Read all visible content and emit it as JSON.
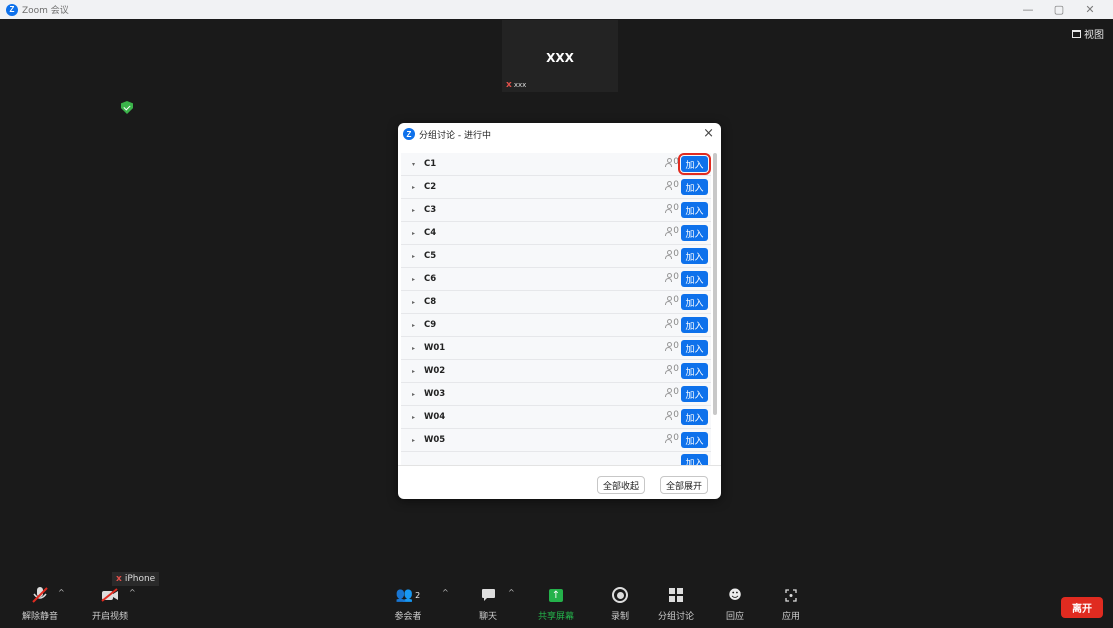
{
  "window": {
    "app_title": "Zoom 会议",
    "logo_letter": "Z",
    "view_label": "视图"
  },
  "participant_tile": {
    "name": "XXX",
    "label": "xxx"
  },
  "breakout_dialog": {
    "title": "分组讨论 - 进行中",
    "close": "×",
    "join_label": "加入",
    "rooms": [
      {
        "name": "C1",
        "count": "0",
        "expanded": true
      },
      {
        "name": "C2",
        "count": "0",
        "expanded": false
      },
      {
        "name": "C3",
        "count": "0",
        "expanded": false
      },
      {
        "name": "C4",
        "count": "0",
        "expanded": false
      },
      {
        "name": "C5",
        "count": "0",
        "expanded": false
      },
      {
        "name": "C6",
        "count": "0",
        "expanded": false
      },
      {
        "name": "C8",
        "count": "0",
        "expanded": false
      },
      {
        "name": "C9",
        "count": "0",
        "expanded": false
      },
      {
        "name": "W01",
        "count": "0",
        "expanded": false
      },
      {
        "name": "W02",
        "count": "0",
        "expanded": false
      },
      {
        "name": "W03",
        "count": "0",
        "expanded": false
      },
      {
        "name": "W04",
        "count": "0",
        "expanded": false
      },
      {
        "name": "W05",
        "count": "0",
        "expanded": false
      }
    ],
    "collapse_all": "全部收起",
    "expand_all": "全部展开"
  },
  "self_view": {
    "name": "iPhone"
  },
  "toolbar": {
    "unmute": "解除静音",
    "start_video": "开启视频",
    "participants": "参会者",
    "participants_count": "2",
    "chat": "聊天",
    "share_screen": "共享屏幕",
    "record": "录制",
    "breakout": "分组讨论",
    "reactions": "回应",
    "apps": "应用",
    "leave": "离开"
  },
  "colors": {
    "accent": "#0e71eb",
    "share_green": "#24b24b",
    "leave_red": "#e02b20",
    "highlight": "#e02b20"
  }
}
